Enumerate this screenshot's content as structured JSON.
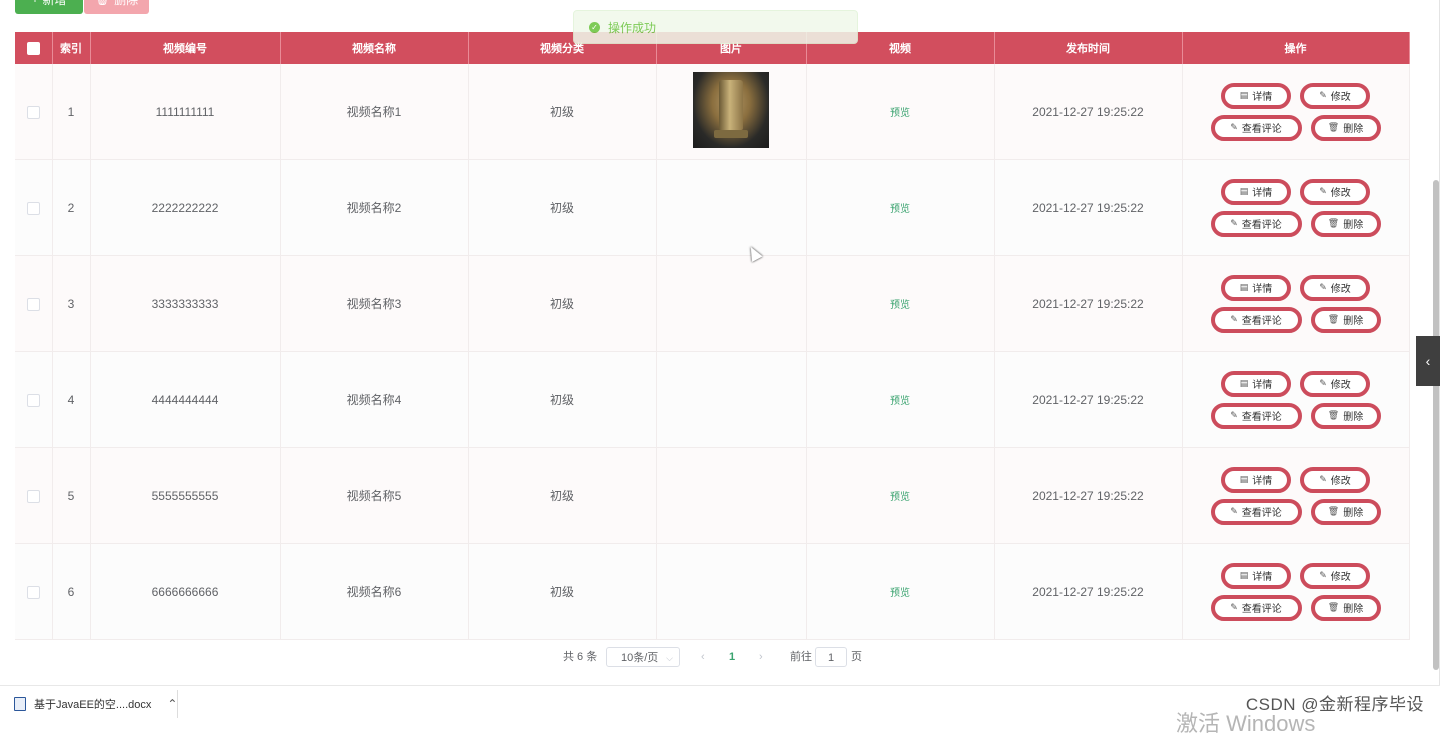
{
  "toolbar": {
    "add_label": "新增",
    "delete_label": "删除"
  },
  "toast": {
    "message": "操作成功"
  },
  "table": {
    "headers": [
      "索引",
      "视频编号",
      "视频名称",
      "视频分类",
      "图片",
      "视频",
      "发布时间",
      "操作"
    ],
    "rows": [
      {
        "index": "1",
        "code": "1111111111",
        "name": "视频名称1",
        "category": "初级",
        "video": "预览",
        "time": "2021-12-27 19:25:22"
      },
      {
        "index": "2",
        "code": "2222222222",
        "name": "视频名称2",
        "category": "初级",
        "video": "预览",
        "time": "2021-12-27 19:25:22"
      },
      {
        "index": "3",
        "code": "3333333333",
        "name": "视频名称3",
        "category": "初级",
        "video": "预览",
        "time": "2021-12-27 19:25:22"
      },
      {
        "index": "4",
        "code": "4444444444",
        "name": "视频名称4",
        "category": "初级",
        "video": "预览",
        "time": "2021-12-27 19:25:22"
      },
      {
        "index": "5",
        "code": "5555555555",
        "name": "视频名称5",
        "category": "初级",
        "video": "预览",
        "time": "2021-12-27 19:25:22"
      },
      {
        "index": "6",
        "code": "6666666666",
        "name": "视频名称6",
        "category": "初级",
        "video": "预览",
        "time": "2021-12-27 19:25:22"
      }
    ],
    "actions": {
      "detail": "详情",
      "edit": "修改",
      "comments": "查看评论",
      "delete": "删除"
    }
  },
  "pagination": {
    "total": "共 6 条",
    "page_size": "10条/页",
    "current_page": "1",
    "goto_prefix": "前往",
    "goto_value": "1",
    "goto_suffix": "页"
  },
  "download_bar": {
    "filename": "基于JavaEE的空....docx"
  },
  "watermark": "CSDN @金新程序毕设",
  "windows_activation": "激活 Windows"
}
